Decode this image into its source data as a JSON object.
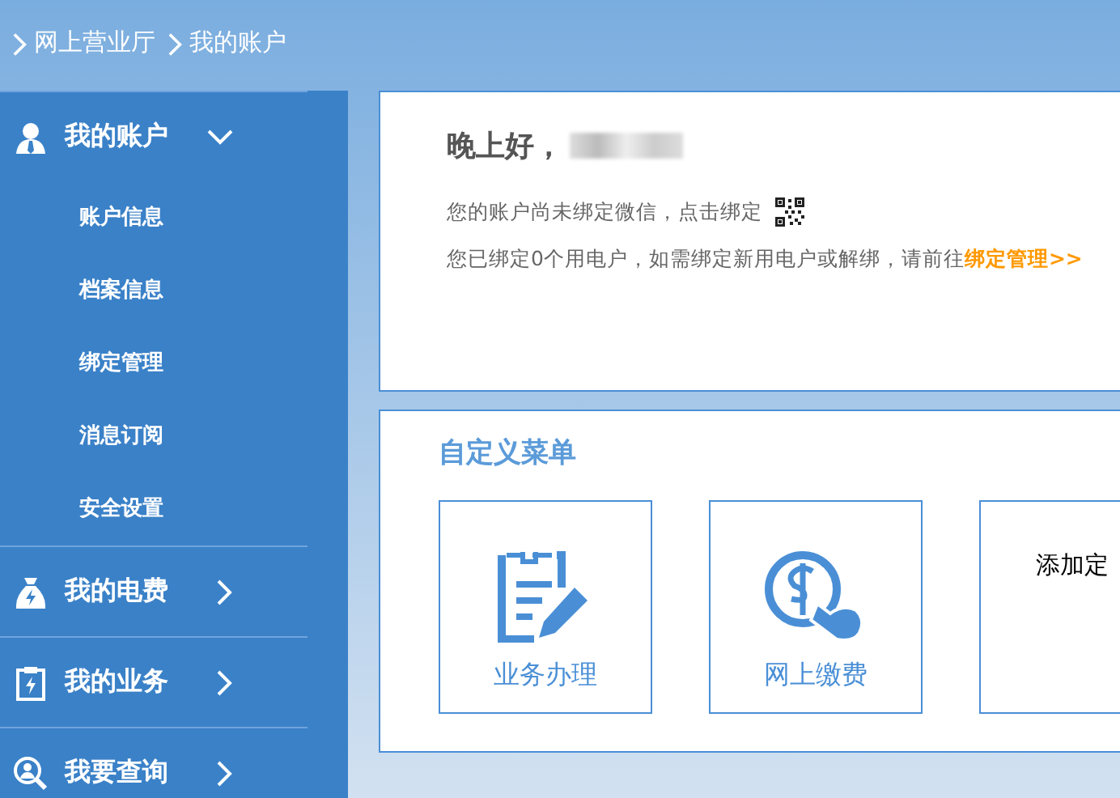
{
  "breadcrumb": [
    "网上营业厅",
    "我的账户"
  ],
  "sidebar": {
    "groups": [
      {
        "label": "我的账户",
        "kind": "user",
        "expanded": true,
        "children": [
          {
            "label": "账户信息"
          },
          {
            "label": "档案信息"
          },
          {
            "label": "绑定管理"
          },
          {
            "label": "消息订阅"
          },
          {
            "label": "安全设置"
          }
        ]
      },
      {
        "label": "我的电费",
        "kind": "bill",
        "expanded": false
      },
      {
        "label": "我的业务",
        "kind": "task",
        "expanded": false
      },
      {
        "label": "我要查询",
        "kind": "query",
        "expanded": false
      }
    ]
  },
  "welcome": {
    "greeting": "晚上好，",
    "notices": [
      {
        "kind": "qr",
        "text": "您的账户尚未绑定微信，点击绑定"
      },
      {
        "kind": "link",
        "text": "您已绑定0个用电户，如需绑定新用电户或解绑，请前往",
        "link": "绑定管理>>"
      }
    ]
  },
  "custom_menu": {
    "title": "自定义菜单",
    "tiles": [
      {
        "kind": "form",
        "label": "业务办理"
      },
      {
        "kind": "payment",
        "label": "网上缴费"
      },
      {
        "kind": "add",
        "label": "添加定"
      }
    ]
  }
}
